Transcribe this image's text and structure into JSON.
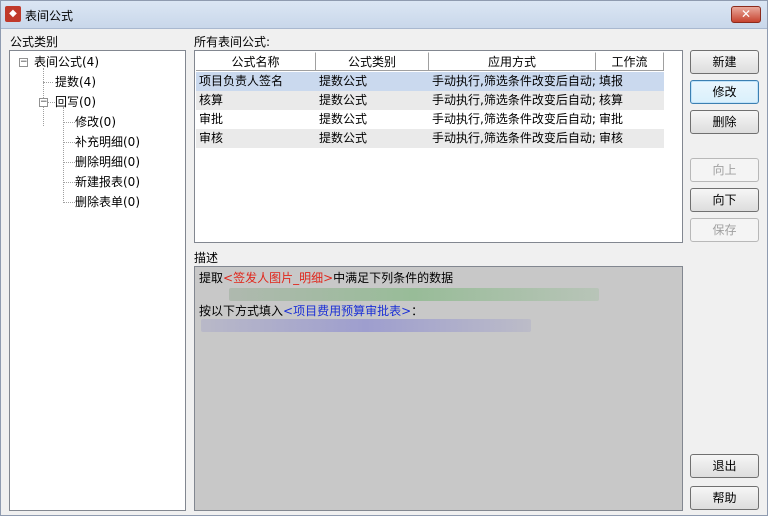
{
  "window": {
    "title": "表间公式",
    "close_label": "✕"
  },
  "left_panel": {
    "label": "公式类别",
    "tree": [
      {
        "label": "表间公式(4)",
        "level": 0,
        "expanded": true
      },
      {
        "label": "提数(4)",
        "level": 1
      },
      {
        "label": "回写(0)",
        "level": 1,
        "expanded": true
      },
      {
        "label": "修改(0)",
        "level": 2
      },
      {
        "label": "补充明细(0)",
        "level": 2
      },
      {
        "label": "删除明细(0)",
        "level": 2
      },
      {
        "label": "新建报表(0)",
        "level": 2
      },
      {
        "label": "删除表单(0)",
        "level": 2
      }
    ]
  },
  "formulas": {
    "label": "所有表间公式:",
    "columns": [
      "公式名称",
      "公式类别",
      "应用方式",
      "工作流"
    ],
    "rows": [
      [
        "项目负责人签名",
        "提数公式",
        "手动执行,筛选条件改变后自动;",
        "填报"
      ],
      [
        "核算",
        "提数公式",
        "手动执行,筛选条件改变后自动;",
        "核算"
      ],
      [
        "审批",
        "提数公式",
        "手动执行,筛选条件改变后自动;",
        "审批"
      ],
      [
        "审核",
        "提数公式",
        "手动执行,筛选条件改变后自动;",
        "审核"
      ]
    ],
    "selected_row": 0
  },
  "description": {
    "label": "描述",
    "line1_prefix": "提取",
    "line1_source": "<签发人图片_明细>",
    "line1_suffix": "中满足下列条件的数据",
    "line3_prefix": "按以下方式填入",
    "line3_target": "<项目费用预算审批表>",
    "line3_suffix": "："
  },
  "buttons": {
    "new": "新建",
    "edit": "修改",
    "delete": "删除",
    "up": "向上",
    "down": "向下",
    "save": "保存",
    "exit": "退出",
    "help": "帮助"
  },
  "colors": {
    "source_table": "#e0261b",
    "target_table": "#1a2fd6",
    "selected_row": "#cad9ee"
  }
}
